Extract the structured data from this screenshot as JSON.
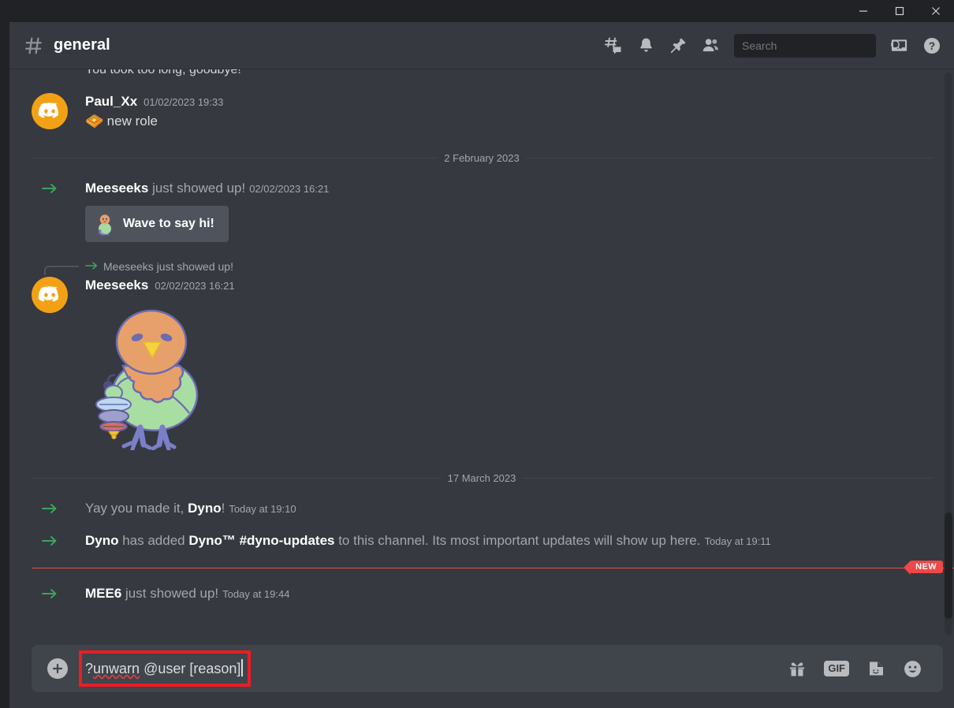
{
  "window": {
    "controls": {
      "minimize": "minimize-icon",
      "maximize": "maximize-icon",
      "close": "close-icon"
    }
  },
  "header": {
    "hash": "#",
    "channel_name": "general",
    "actions": [
      {
        "name": "threads-icon",
        "label": "Threads"
      },
      {
        "name": "bell-icon",
        "label": "Notification Settings"
      },
      {
        "name": "pin-icon",
        "label": "Pinned Messages"
      },
      {
        "name": "members-icon",
        "label": "Member List"
      }
    ],
    "search": {
      "placeholder": "Search",
      "value": "",
      "icon": "search-icon"
    },
    "inbox": "inbox-icon",
    "help": "help-icon"
  },
  "messages": {
    "clipped_top_text": "You took too long, goodbye!",
    "items": [
      {
        "type": "user",
        "author": "Paul_Xx",
        "timestamp": "01/02/2023 19:33",
        "emoji": "🧇",
        "text": "new role"
      },
      {
        "type": "divider",
        "label": "2 February 2023"
      },
      {
        "type": "system",
        "author": "Meeseeks",
        "text": " just showed up!",
        "timestamp": "02/02/2023 16:21",
        "button": {
          "label": "Wave to say hi!",
          "icon": "wave-sticker-icon"
        }
      },
      {
        "type": "reply",
        "reference_text": "Meeseeks just showed up!",
        "author": "Meeseeks",
        "timestamp": "02/02/2023 16:21",
        "sticker": "bird-with-toy-sticker"
      },
      {
        "type": "divider",
        "label": "17 March 2023"
      },
      {
        "type": "system",
        "prefix": "Yay you made it, ",
        "author": "Dyno",
        "text": "!",
        "timestamp": "Today at 19:10"
      },
      {
        "type": "system",
        "author": "Dyno",
        "text": " has added ",
        "bold2": "Dyno™ #dyno-updates",
        "text2": " to this channel. Its most important updates will show up here.",
        "timestamp": "Today at 19:11"
      },
      {
        "type": "new_divider",
        "badge": "NEW"
      },
      {
        "type": "system",
        "author": "MEE6",
        "text": " just showed up!",
        "timestamp": "Today at 19:44"
      }
    ]
  },
  "composer": {
    "add_button": "plus-icon",
    "text_before": "?",
    "text_misspelled": "unwarn",
    "text_after": " @user [reason]",
    "full_text": "?unwarn @user [reason]",
    "actions": [
      {
        "name": "gift-icon",
        "label": "Gift"
      },
      {
        "name": "gif-icon",
        "label": "GIF"
      },
      {
        "name": "sticker-icon",
        "label": "Sticker"
      },
      {
        "name": "emoji-icon",
        "label": "Emoji"
      }
    ]
  },
  "colors": {
    "accent_red": "#ed1c24",
    "new_red": "#f04747",
    "green_arrow": "#3ba55d",
    "avatar_orange": "#f2a115",
    "chat_bg": "#36393f",
    "chrome_bg": "#202225"
  }
}
